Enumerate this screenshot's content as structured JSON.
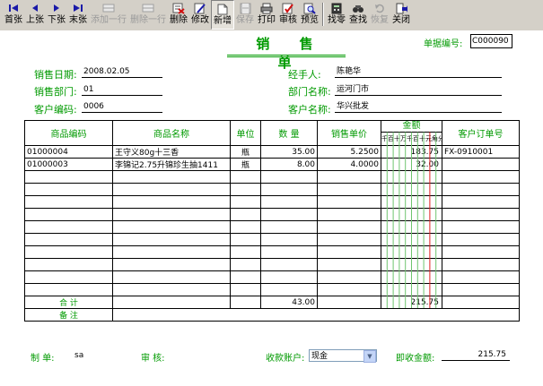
{
  "toolbar": {
    "buttons": [
      {
        "label": "首张",
        "icon": "first-icon"
      },
      {
        "label": "上张",
        "icon": "prev-icon"
      },
      {
        "label": "下张",
        "icon": "next-icon"
      },
      {
        "label": "末张",
        "icon": "last-icon"
      },
      {
        "label": "添加一行",
        "icon": "add-row-icon"
      },
      {
        "label": "删除一行",
        "icon": "delete-row-icon"
      },
      {
        "label": "删除",
        "icon": "delete-icon"
      },
      {
        "label": "修改",
        "icon": "edit-icon"
      },
      {
        "label": "新增",
        "icon": "new-icon"
      },
      {
        "label": "保存",
        "icon": "save-icon"
      },
      {
        "label": "打印",
        "icon": "print-icon"
      },
      {
        "label": "审核",
        "icon": "approve-icon"
      },
      {
        "label": "预览",
        "icon": "preview-icon"
      },
      {
        "label": "找零",
        "icon": "change-icon"
      },
      {
        "label": "查找",
        "icon": "find-icon"
      },
      {
        "label": "恢复",
        "icon": "restore-icon"
      },
      {
        "label": "关闭",
        "icon": "close-icon"
      }
    ]
  },
  "form": {
    "title": "销 售 单",
    "doc_no_label": "单据编号:",
    "doc_no": "C000090",
    "sale_date_label": "销售日期:",
    "sale_date": "2008.02.05",
    "dept_label": "销售部门:",
    "dept": "01",
    "customer_code_label": "客户编码:",
    "customer_code": "0006",
    "handler_label": "经手人:",
    "handler": "陈艳华",
    "dept_name_label": "部门名称:",
    "dept_name": "运河门市",
    "customer_name_label": "客户名称:",
    "customer_name": "华兴批发"
  },
  "table": {
    "headers": {
      "code": "商品编码",
      "name": "商品名称",
      "unit": "单位",
      "qty": "数 量",
      "price": "销售单价",
      "amount": "金额",
      "units": [
        "千",
        "百",
        "十",
        "万",
        "千",
        "百",
        "十",
        "元",
        "角",
        "分"
      ],
      "order": "客户订单号"
    },
    "rows": [
      {
        "code": "01000004",
        "name": "王守义80g十三香",
        "unit": "瓶",
        "qty": "35.00",
        "price": "5.2500",
        "amount": "183.75",
        "order": "FX-0910001"
      },
      {
        "code": "01000003",
        "name": "李锦记2.75升锦珍生抽1411",
        "unit": "瓶",
        "qty": "8.00",
        "price": "4.0000",
        "amount": "32.00",
        "order": ""
      }
    ],
    "empty_rows": 10,
    "total_label": "合 计",
    "total_qty": "43.00",
    "total_amount": "215.75",
    "remark_label": "备 注"
  },
  "footer": {
    "maker_label": "制  单:",
    "maker": "sa",
    "auditor_label": "审  核:",
    "account_label": "收款账户:",
    "account": "现金",
    "receivable_label": "即收金额:",
    "receivable": "215.75"
  }
}
